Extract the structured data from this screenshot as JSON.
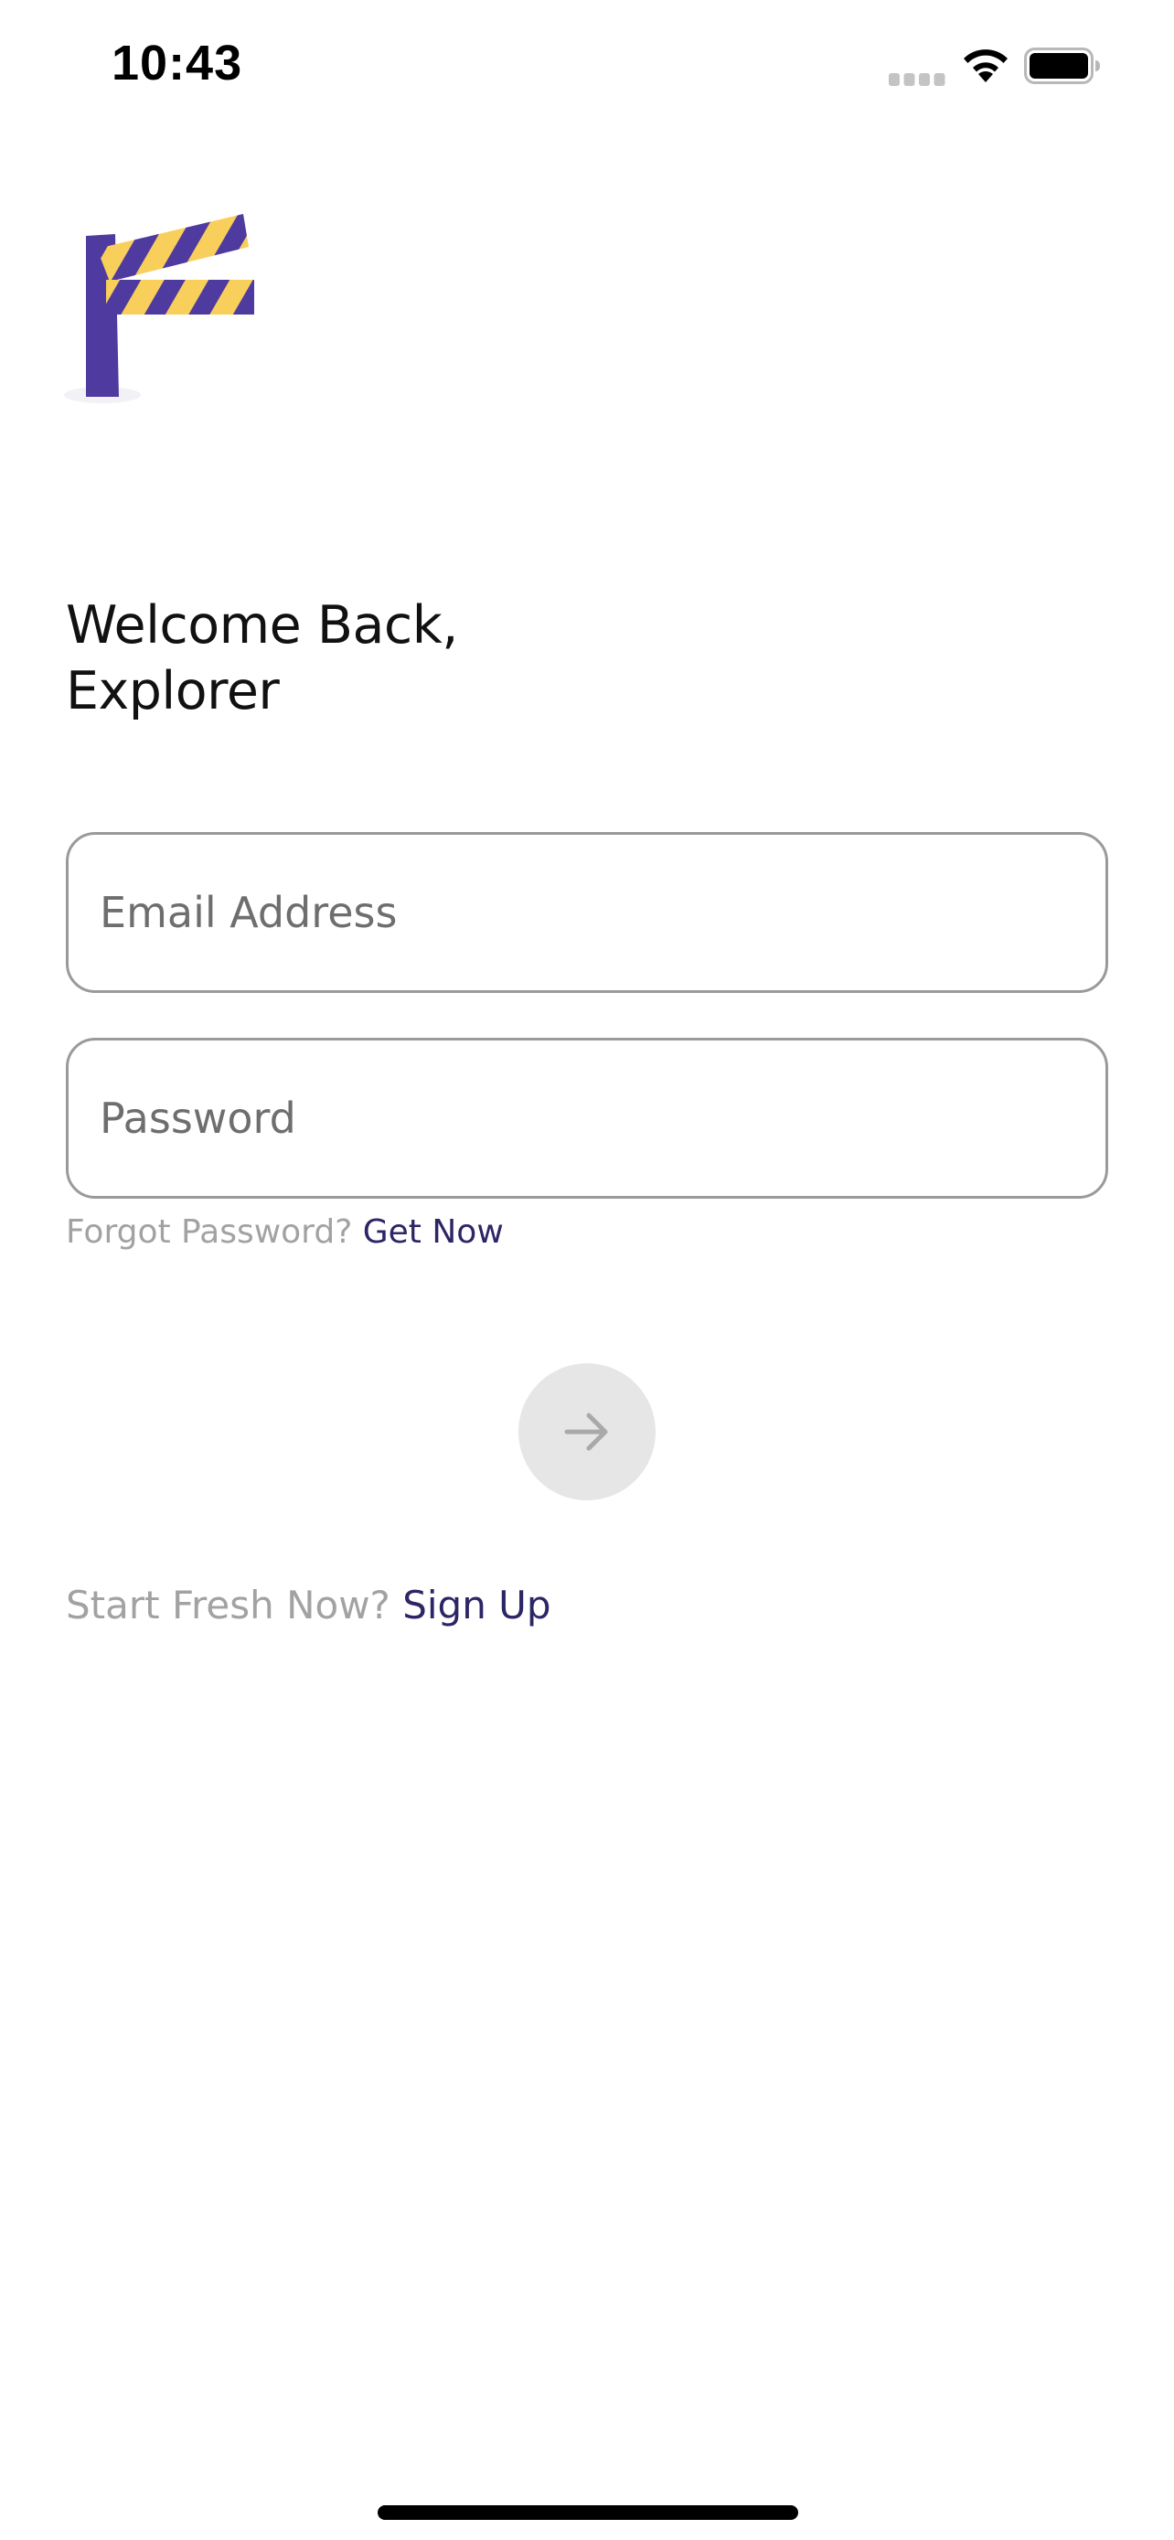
{
  "status_bar": {
    "time": "10:43"
  },
  "icons": {
    "signal": "cellular-signal-icon",
    "wifi": "wifi-icon",
    "battery": "battery-icon",
    "logo": "road-barrier-flag-logo",
    "submit": "arrow-right-icon"
  },
  "colors": {
    "logo_purple": "#4f3aa0",
    "logo_yellow": "#f8cf5a",
    "link": "#2c2566",
    "muted_text": "#a2a2a2",
    "button_disabled": "#e6e6e6"
  },
  "welcome": {
    "line1": "Welcome Back,",
    "line2": "Explorer"
  },
  "form": {
    "email_placeholder": "Email Address",
    "email_value": "",
    "password_placeholder": "Password",
    "password_value": ""
  },
  "forgot": {
    "prompt": "Forgot Password?",
    "link": "Get Now"
  },
  "signup": {
    "prompt": "Start Fresh Now?",
    "link": "Sign Up"
  }
}
